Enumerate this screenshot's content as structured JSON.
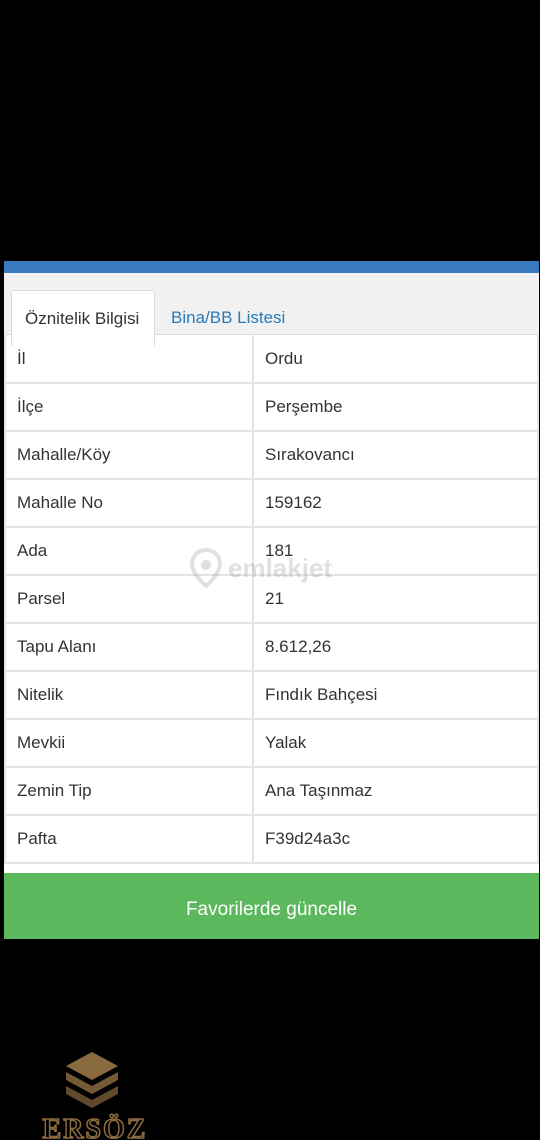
{
  "tabs": {
    "active": "Öznitelik Bilgisi",
    "inactive": "Bina/BB Listesi"
  },
  "rows": [
    {
      "key": "İl",
      "value": "Ordu"
    },
    {
      "key": "İlçe",
      "value": "Perşembe"
    },
    {
      "key": "Mahalle/Köy",
      "value": "Sırakovancı"
    },
    {
      "key": "Mahalle No",
      "value": "159162"
    },
    {
      "key": "Ada",
      "value": "181"
    },
    {
      "key": "Parsel",
      "value": "21"
    },
    {
      "key": "Tapu Alanı",
      "value": "8.612,26"
    },
    {
      "key": "Nitelik",
      "value": "Fındık Bahçesi"
    },
    {
      "key": "Mevkii",
      "value": "Yalak"
    },
    {
      "key": "Zemin Tip",
      "value": "Ana Taşınmaz"
    },
    {
      "key": "Pafta",
      "value": "F39d24a3c"
    }
  ],
  "button": {
    "label": "Favorilerde güncelle"
  },
  "watermark": {
    "text": "emlakjet",
    "icon": "location-pin-icon"
  },
  "brand_logo": {
    "text": "ERSÖZ",
    "icon": "stacked-layers-icon",
    "color": "#8a6a3f"
  },
  "colors": {
    "topbar": "#3a7bbf",
    "tab_link": "#2a7ab8",
    "button": "#5cb85c"
  }
}
